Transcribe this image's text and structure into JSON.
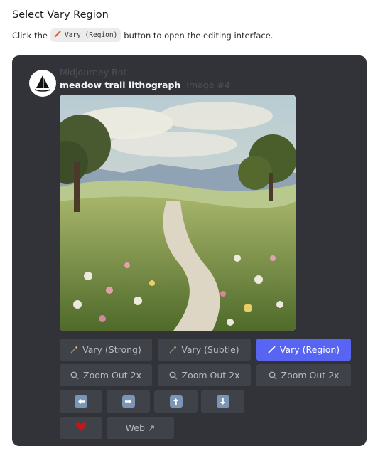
{
  "page": {
    "heading": "Select Vary Region",
    "instruction_before": "Click the",
    "instruction_code": "Vary (Region)",
    "instruction_after": "button to open the editing interface."
  },
  "message": {
    "bot_name": "Midjourney Bot",
    "prompt": "meadow trail lithograph",
    "image_label": "Image #4"
  },
  "buttons": {
    "vary_strong": "Vary (Strong)",
    "vary_subtle": "Vary (Subtle)",
    "vary_region": "Vary (Region)",
    "zoom_out_1": "Zoom Out 2x",
    "zoom_out_2": "Zoom Out 2x",
    "zoom_out_3": "Zoom Out 2x",
    "web": "Web ↗"
  },
  "icons": {
    "magic_wand": "magic-wand-icon",
    "pencil": "pencil-icon",
    "magnifier": "magnifying-glass-icon",
    "arrows": [
      "arrow-left-icon",
      "arrow-right-icon",
      "arrow-up-icon",
      "arrow-down-icon"
    ],
    "heart": "heart-icon"
  },
  "colors": {
    "card_bg": "#313338",
    "button_bg": "#404249",
    "primary": "#5865f2",
    "heart": "#c4151c"
  }
}
